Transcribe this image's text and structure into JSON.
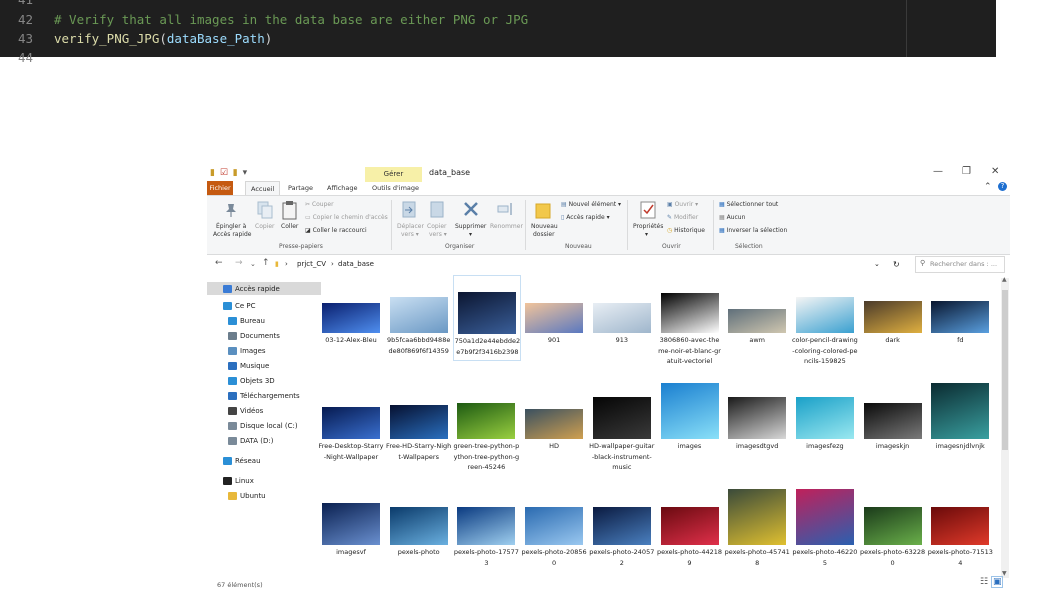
{
  "editor": {
    "lines": [
      {
        "num": "41",
        "code": ""
      },
      {
        "num": "42",
        "code": "# Verify that all images in the data base are either PNG or JPG"
      },
      {
        "num": "43",
        "func": "verify_PNG_JPG",
        "open": "(",
        "arg": "dataBase_Path",
        "close": ")"
      },
      {
        "num": "44",
        "code": ""
      }
    ]
  },
  "explorer": {
    "context_tab": "Gérer",
    "window_title": "data_base",
    "window_controls": {
      "minimize": "—",
      "maximize": "❐",
      "close": "✕"
    },
    "tabs": [
      "Fichier",
      "Accueil",
      "Partage",
      "Affichage",
      "Outils d'image"
    ],
    "ribbon": {
      "pin_label_1": "Épingler à",
      "pin_label_2": "Accès rapide",
      "copy": "Copier",
      "paste": "Coller",
      "cut": "Couper",
      "copy_path": "Copier le chemin d'accès",
      "paste_shortcut": "Coller le raccourci",
      "group_clipboard": "Presse-papiers",
      "move_1": "Déplacer",
      "move_2": "vers ▾",
      "copyto_1": "Copier",
      "copyto_2": "vers ▾",
      "delete": "Supprimer",
      "delete_2": "▾",
      "rename": "Renommer",
      "group_organize": "Organiser",
      "new_folder_1": "Nouveau",
      "new_folder_2": "dossier",
      "new_item": "Nouvel élément ▾",
      "quick_access": "Accès rapide ▾",
      "group_new": "Nouveau",
      "properties": "Propriétés",
      "properties_2": "▾",
      "open": "Ouvrir ▾",
      "modify": "Modifier",
      "history": "Historique",
      "group_open": "Ouvrir",
      "select_all": "Sélectionner tout",
      "select_none": "Aucun",
      "invert_selection": "Inverser la sélection",
      "group_select": "Sélection"
    },
    "address": {
      "back": "←",
      "forward": "→",
      "up": "↑",
      "path": [
        "prjct_CV",
        "data_base"
      ],
      "sep": "›",
      "dropdown": "⌄",
      "refresh": "↻",
      "search_placeholder": "Rechercher dans : ..."
    },
    "nav": [
      {
        "label": "Accès rapide",
        "icon": "star-icon",
        "color": "#3a7bd5",
        "indent": 0,
        "selected": true
      },
      {
        "label": "Ce PC",
        "icon": "computer-icon",
        "color": "#2b8fd6",
        "indent": 0
      },
      {
        "label": "Bureau",
        "icon": "desktop-icon",
        "color": "#2b8fd6",
        "indent": 1
      },
      {
        "label": "Documents",
        "icon": "document-icon",
        "color": "#6b7d8c",
        "indent": 1
      },
      {
        "label": "Images",
        "icon": "images-icon",
        "color": "#5a8fbf",
        "indent": 1
      },
      {
        "label": "Musique",
        "icon": "music-icon",
        "color": "#2b6fbf",
        "indent": 1
      },
      {
        "label": "Objets 3D",
        "icon": "cube-icon",
        "color": "#2b8fd6",
        "indent": 1
      },
      {
        "label": "Téléchargements",
        "icon": "download-icon",
        "color": "#2b6fbf",
        "indent": 1
      },
      {
        "label": "Vidéos",
        "icon": "video-icon",
        "color": "#444444",
        "indent": 1
      },
      {
        "label": "Disque local (C:)",
        "icon": "drive-icon",
        "color": "#7a8a99",
        "indent": 1
      },
      {
        "label": "DATA (D:)",
        "icon": "drive-icon",
        "color": "#7a8a99",
        "indent": 1
      },
      {
        "label": "Réseau",
        "icon": "network-icon",
        "color": "#2b8fd6",
        "indent": 0
      },
      {
        "label": "Linux",
        "icon": "linux-icon",
        "color": "#222222",
        "indent": 0
      },
      {
        "label": "Ubuntu",
        "icon": "folder-icon",
        "color": "#e8b83a",
        "indent": 1
      }
    ],
    "files": [
      {
        "name": "03-12-Alex-Bleu",
        "c1": "#0a1f6e",
        "c2": "#4f8ff0",
        "h": 30
      },
      {
        "name": "9b5fcaa6bbd9488ede80f869f6f14359",
        "c1": "#c9dff2",
        "c2": "#6a98c4",
        "h": 36
      },
      {
        "name": "750a1d2e44ebdde2e7b9f2f3416b2398",
        "c1": "#0b1530",
        "c2": "#3a5f9a",
        "h": 42,
        "focus": true
      },
      {
        "name": "901",
        "c1": "#f2c49a",
        "c2": "#5a78c0",
        "h": 30
      },
      {
        "name": "913",
        "c1": "#e8eef4",
        "c2": "#9fb6cc",
        "h": 30
      },
      {
        "name": "3806860-avec-theme-noir-et-blanc-gratuit-vectoriel",
        "c1": "#000000",
        "c2": "#ffffff",
        "h": 40
      },
      {
        "name": "awm",
        "c1": "#5f6f7a",
        "c2": "#d0c7b0",
        "h": 24
      },
      {
        "name": "color-pencil-drawing-coloring-colored-pencils-159825",
        "c1": "#f5f5f5",
        "c2": "#3aa0d0",
        "h": 36
      },
      {
        "name": "dark",
        "c1": "#4a3a2a",
        "c2": "#e0b040",
        "h": 32
      },
      {
        "name": "fd",
        "c1": "#08152e",
        "c2": "#5aa0e0",
        "h": 32
      },
      {
        "name": "Free-Desktop-Starry-Night-Wallpaper",
        "c1": "#061a50",
        "c2": "#3a70d0",
        "h": 32
      },
      {
        "name": "Free-HD-Starry-Night-Wallpapers",
        "c1": "#061030",
        "c2": "#2a70c0",
        "h": 34
      },
      {
        "name": "green-tree-python-python-tree-python-green-45246",
        "c1": "#1d5a12",
        "c2": "#9ad040",
        "h": 36
      },
      {
        "name": "HD",
        "c1": "#3a5060",
        "c2": "#d0a050",
        "h": 30
      },
      {
        "name": "HD-wallpaper-guitar-black-instrument-music",
        "c1": "#050505",
        "c2": "#3a3a3a",
        "h": 42
      },
      {
        "name": "images",
        "c1": "#1a7fd0",
        "c2": "#8ae0f8",
        "h": 56
      },
      {
        "name": "imagesdtgvd",
        "c1": "#1a1a1a",
        "c2": "#d8d8d8",
        "h": 42
      },
      {
        "name": "imagesfezg",
        "c1": "#1aa0c8",
        "c2": "#9ae8f0",
        "h": 42
      },
      {
        "name": "imageskjn",
        "c1": "#0a0a0a",
        "c2": "#7a7a7a",
        "h": 36
      },
      {
        "name": "imagesnjdlvnjk",
        "c1": "#0a2a30",
        "c2": "#3aa0a0",
        "h": 56
      },
      {
        "name": "imagesvf",
        "c1": "#0a2050",
        "c2": "#6a90d0",
        "h": 42
      },
      {
        "name": "pexels-photo",
        "c1": "#0a3a6a",
        "c2": "#6ab0e0",
        "h": 38
      },
      {
        "name": "pexels-photo-175773",
        "c1": "#0a3a80",
        "c2": "#a0d0f0",
        "h": 38
      },
      {
        "name": "pexels-photo-208560",
        "c1": "#2a6ab0",
        "c2": "#9ac8f0",
        "h": 38
      },
      {
        "name": "pexels-photo-240572",
        "c1": "#0a1a40",
        "c2": "#4a80c0",
        "h": 38
      },
      {
        "name": "pexels-photo-442189",
        "c1": "#6a0a10",
        "c2": "#e0304a",
        "h": 38
      },
      {
        "name": "pexels-photo-457418",
        "c1": "#3a4a3a",
        "c2": "#e0c030",
        "h": 56
      },
      {
        "name": "pexels-photo-462205",
        "c1": "#c0205a",
        "c2": "#2a60b0",
        "h": 56
      },
      {
        "name": "pexels-photo-632280",
        "c1": "#1a3a1a",
        "c2": "#6ab04a",
        "h": 38
      },
      {
        "name": "pexels-photo-715134",
        "c1": "#6a0a0a",
        "c2": "#e03a2a",
        "h": 38
      },
      {
        "name": "",
        "c1": "#7a6a50",
        "c2": "#c0b090",
        "h": 16
      },
      {
        "name": "",
        "c1": "#2a3a5a",
        "c2": "#9ab0c8",
        "h": 16
      }
    ],
    "status": "67 élément(s)"
  }
}
